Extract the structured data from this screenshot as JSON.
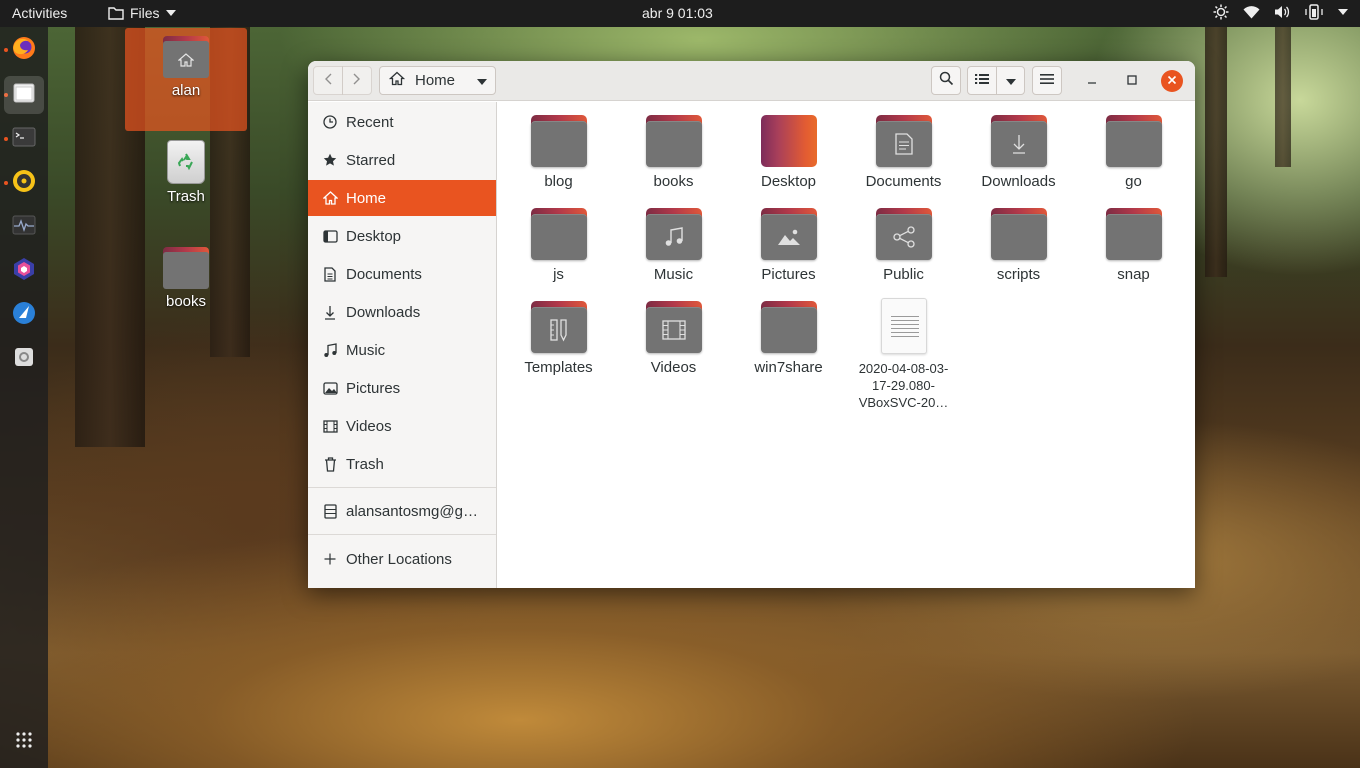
{
  "topbar": {
    "activities": "Activities",
    "app_menu": "Files",
    "clock": "abr 9  01:03"
  },
  "dock": {
    "items": [
      "firefox",
      "files",
      "terminal",
      "rhythmbox",
      "system-monitor",
      "app",
      "vscode",
      "settings",
      "show-applications"
    ]
  },
  "desktop": {
    "icons": [
      {
        "label": "alan"
      },
      {
        "label": "Trash"
      },
      {
        "label": "books"
      }
    ]
  },
  "window": {
    "path": "Home",
    "sidebar": [
      {
        "label": "Recent",
        "icon": "clock-icon"
      },
      {
        "label": "Starred",
        "icon": "star-icon"
      },
      {
        "label": "Home",
        "icon": "home-icon"
      },
      {
        "label": "Desktop",
        "icon": "desktop-icon"
      },
      {
        "label": "Documents",
        "icon": "document-icon"
      },
      {
        "label": "Downloads",
        "icon": "download-icon"
      },
      {
        "label": "Music",
        "icon": "music-icon"
      },
      {
        "label": "Pictures",
        "icon": "picture-icon"
      },
      {
        "label": "Videos",
        "icon": "video-icon"
      },
      {
        "label": "Trash",
        "icon": "trash-icon"
      },
      {
        "label": "alansantosmg@g…",
        "icon": "network-drive-icon"
      },
      {
        "label": "Other Locations",
        "icon": "plus-icon"
      }
    ],
    "files": [
      {
        "name": "blog"
      },
      {
        "name": "books"
      },
      {
        "name": "Desktop"
      },
      {
        "name": "Documents"
      },
      {
        "name": "Downloads"
      },
      {
        "name": "go"
      },
      {
        "name": "js"
      },
      {
        "name": "Music"
      },
      {
        "name": "Pictures"
      },
      {
        "name": "Public"
      },
      {
        "name": "scripts"
      },
      {
        "name": "snap"
      },
      {
        "name": "Templates"
      },
      {
        "name": "Videos"
      },
      {
        "name": "win7share"
      },
      {
        "name": "2020-04-08-03-17-29.080-VBoxSVC-20…",
        "lines": [
          "2020-04-08-03-",
          "17-29.080-",
          "VBoxSVC-20…"
        ]
      }
    ]
  },
  "colors": {
    "accent": "#e95420",
    "folder_body": "#737373"
  }
}
